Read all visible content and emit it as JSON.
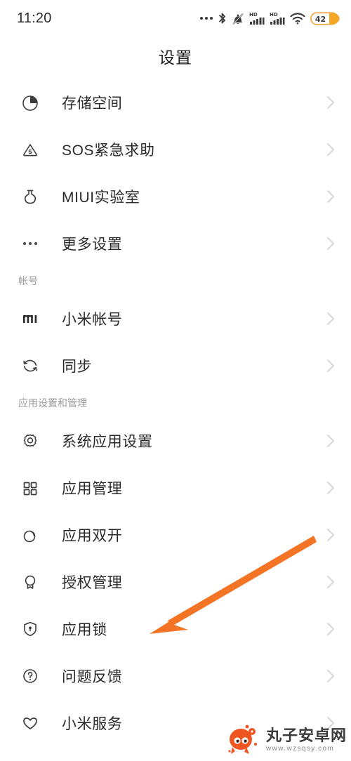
{
  "status_bar": {
    "time": "11:20",
    "battery_level": "42",
    "icons": [
      "more-dots-icon",
      "bluetooth-icon",
      "mute-bell-icon",
      "hd-signal-icon",
      "hd-signal-icon",
      "wifi-icon",
      "battery-icon"
    ],
    "hd_label": "HD"
  },
  "header": {
    "title": "设置"
  },
  "sections": [
    {
      "header": null,
      "items": [
        {
          "icon": "storage-pie-icon",
          "label": "存储空间"
        },
        {
          "icon": "sos-triangle-icon",
          "label": "SOS紧急求助"
        },
        {
          "icon": "flask-icon",
          "label": "MIUI实验室"
        },
        {
          "icon": "more-dots-icon",
          "label": "更多设置"
        }
      ]
    },
    {
      "header": "帐号",
      "items": [
        {
          "icon": "mi-logo-icon",
          "label": "小米帐号"
        },
        {
          "icon": "sync-icon",
          "label": "同步"
        }
      ]
    },
    {
      "header": "应用设置和管理",
      "items": [
        {
          "icon": "gear-icon",
          "label": "系统应用设置"
        },
        {
          "icon": "grid-apps-icon",
          "label": "应用管理"
        },
        {
          "icon": "dual-circles-icon",
          "label": "应用双开"
        },
        {
          "icon": "award-badge-icon",
          "label": "授权管理"
        },
        {
          "icon": "shield-lock-icon",
          "label": "应用锁"
        },
        {
          "icon": "question-icon",
          "label": "问题反馈"
        },
        {
          "icon": "heart-icon",
          "label": "小米服务"
        }
      ]
    }
  ],
  "annotation": {
    "type": "arrow",
    "color": "#F47425",
    "points_to": "应用锁"
  },
  "watermark": {
    "site_name": "丸子安卓网",
    "url": "www.wzsqsy.com",
    "logo": "mascot-icon",
    "color": "#EE5520"
  },
  "colors": {
    "background": "#ffffff",
    "text_primary": "#2a2a2a",
    "text_secondary": "#9b9b9b",
    "chevron": "#d4d4d4",
    "accent_orange": "#F47425"
  }
}
